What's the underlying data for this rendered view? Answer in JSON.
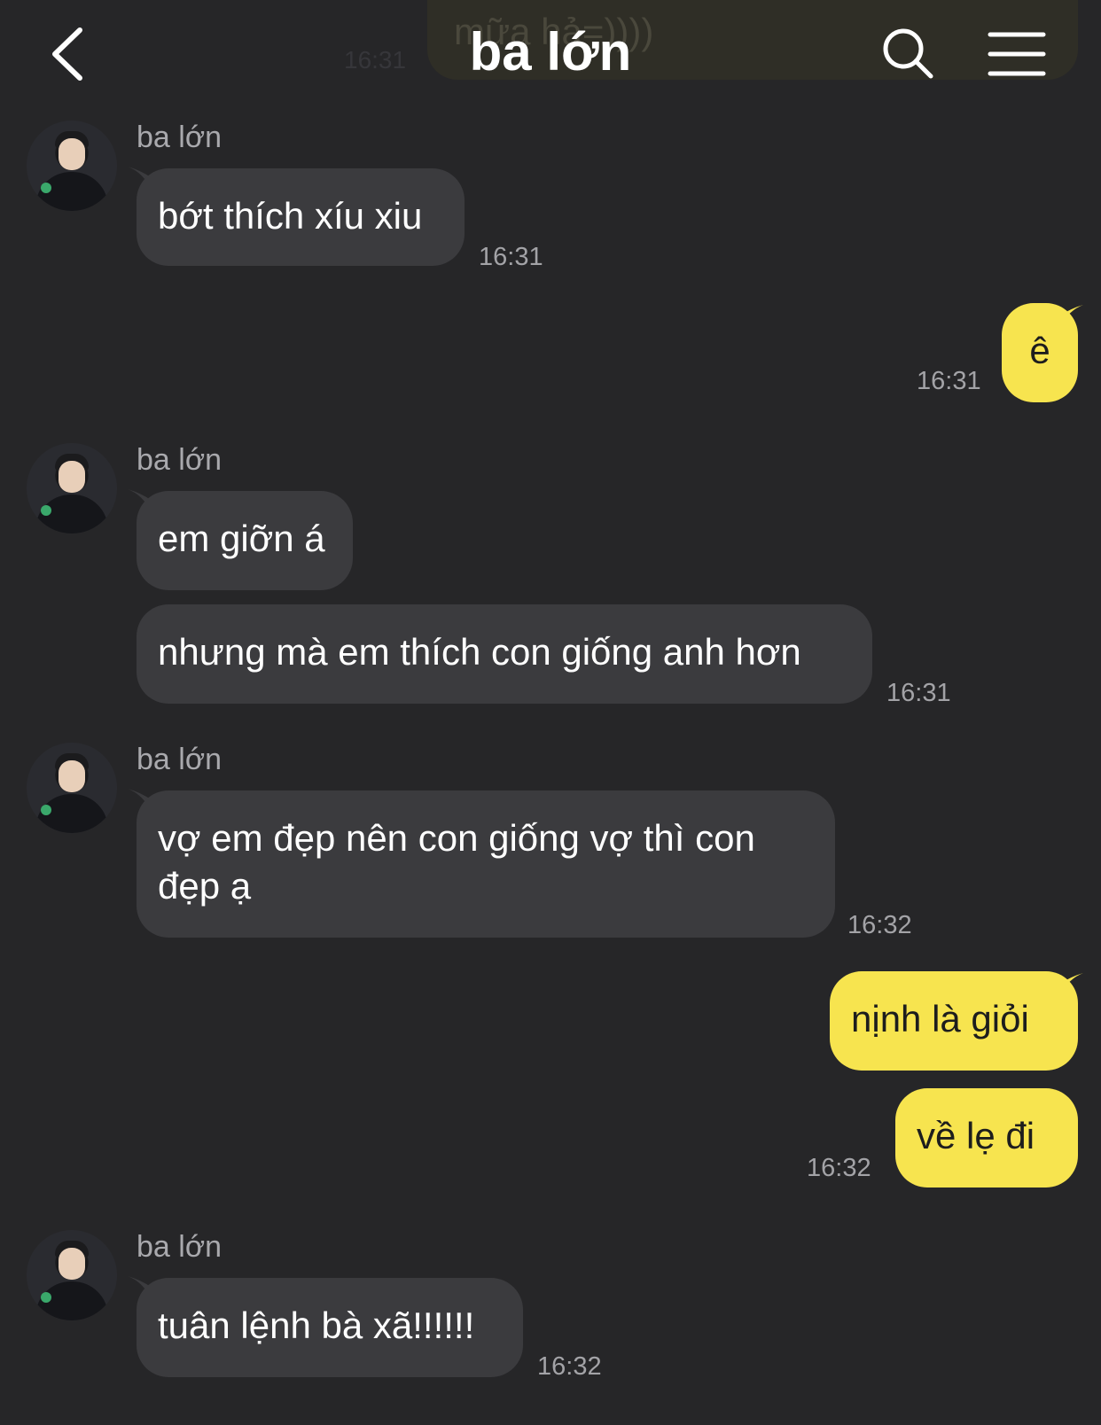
{
  "header": {
    "title": "ba lớn",
    "ghost_message": "mữa hả=))))",
    "ghost_time": "16:31"
  },
  "icons": {
    "back": "chevron-left-icon",
    "search": "search-icon",
    "menu": "hamburger-menu-icon"
  },
  "colors": {
    "background": "#262628",
    "incoming_bubble": "#3b3b3e",
    "outgoing_bubble": "#f7e44f"
  },
  "messages": [
    {
      "direction": "in",
      "sender": "ba lớn",
      "text": "bớt thích xíu xiu",
      "time": "16:31"
    },
    {
      "direction": "out",
      "text": "ê",
      "time": "16:31"
    },
    {
      "direction": "in",
      "sender": "ba lớn",
      "text": "em giỡn á",
      "time": ""
    },
    {
      "direction": "in",
      "text": "nhưng mà em thích con giống anh hơn",
      "time": "16:31"
    },
    {
      "direction": "in",
      "sender": "ba lớn",
      "text": "vợ em đẹp nên con giống vợ thì con đẹp ạ",
      "time": "16:32"
    },
    {
      "direction": "out",
      "text": "nịnh là giỏi",
      "time": ""
    },
    {
      "direction": "out",
      "text": "về lẹ đi",
      "time": "16:32"
    },
    {
      "direction": "in",
      "sender": "ba lớn",
      "text": "tuân lệnh bà xã!!!!!!",
      "time": "16:32"
    }
  ]
}
